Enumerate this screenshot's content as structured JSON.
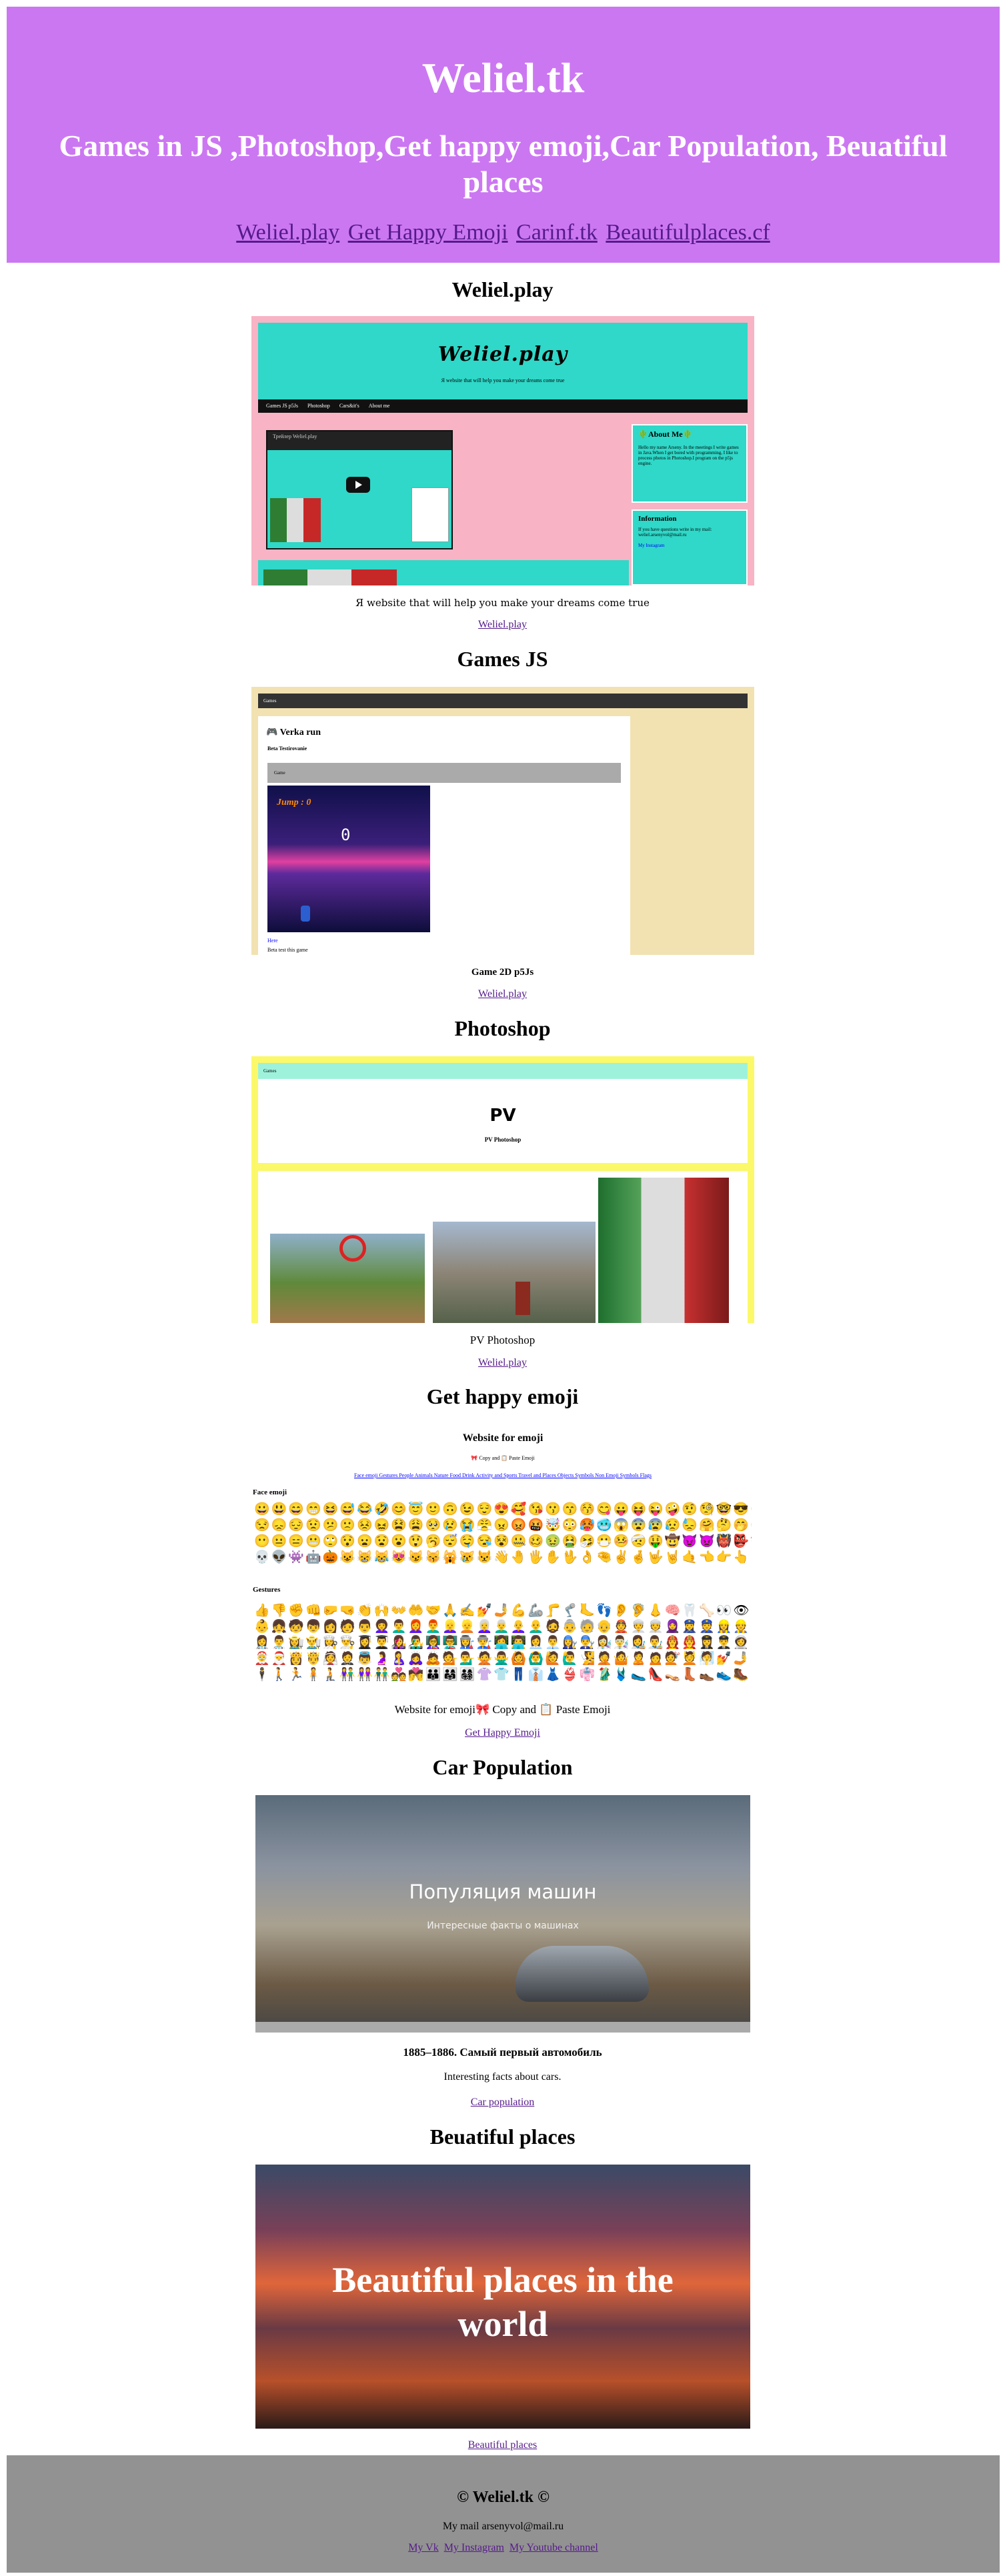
{
  "header": {
    "title": "Weliel.tk",
    "subtitle": "Games in JS ,Photoshop,Get happy emoji,Car Population, Beuatiful places",
    "nav": [
      "Weliel.play",
      "Get Happy Emoji",
      "Carinf.tk",
      "Beautifulplaces.cf"
    ]
  },
  "sections": {
    "welielplay": {
      "title": "Weliel.play",
      "caption": "Я website that will help you make your dreams come true",
      "link": "Weliel.play",
      "shot": {
        "logo": "Weliel.play",
        "tagline": "Я website that will help you make your dreams come true",
        "menu": [
          "Games JS p5Js",
          "Photoshop",
          "Cars&it's",
          "About me"
        ],
        "video_title": "Трейлер Weliel.play",
        "about_title": "🌵About Me🌵",
        "about_text": "Hello my name Arseny. In the meetings I write games in Java.When I get bored with programming, I like to process photos in Photoshop.I program on the p5js engine.",
        "info_title": "Information",
        "info_text": "If you have questions write in my mail: weliel.arsenyvol@mail.ru",
        "info_link": "My Instagram"
      }
    },
    "games": {
      "title": "Games JS",
      "caption": "Game 2D p5Js",
      "link": "Weliel.play",
      "shot": {
        "topbar": "Games",
        "game_title": "🎮 Verka run",
        "version": "Beta Testirovanie",
        "bar_label": "Game",
        "jump": "Jump : 0",
        "score": "0",
        "link_text": "Here",
        "sub": "Beta test this game"
      }
    },
    "photoshop": {
      "title": "Photoshop",
      "caption": "PV Photoshop",
      "link": "Weliel.play",
      "shot": {
        "nav": "Games",
        "logo": "PV",
        "sub": "PV Photoshop"
      }
    },
    "emoji": {
      "title": "Get happy emoji",
      "caption": "Website for emoji🎀 Copy and 📋 Paste Emoji",
      "link": "Get Happy Emoji",
      "shot": {
        "heading": "Website for emoji",
        "copy": "🎀 Copy and 📋 Paste Emoji",
        "cats": "Face emoji Gestures People Animals Nature Food Drink Activity and Sports Travel and Places Objects Symbols Non Emoji Symbols Flags",
        "face_label": "Face emoji",
        "gestures_label": "Gestures",
        "face_rows": [
          "😀😃😄😁😆😅😂🤣😊😇🙂🙃😉😌😍🥰😘😗😙😚😋😛😝😜🤪🤨🧐🤓😎🤩🥳😏",
          "😒😞😔😟😕🙁😣😖😫😩🥺😢😭😤😠😡🤬🤯😳🥵🥶😱😨😰😥😓🤗🤔🤭🤫🤥",
          "😶😐😑😬🙄😯😦😧😮😲🥱😴🤤😪😵🤐🥴🤢🤮🤧😷🤒🤕🤑🤠😈👿👹👺🤡💩👻",
          "💀👽👾🤖🎃😺😸😹😻😼😽🙀😿😾👋🤚🖐✋🖖👌🤏✌🤞🤟🤘🤙👈👉👆🖕👇☝"
        ],
        "gesture_rows": [
          "👍👎✊👊🤛🤜👏🙌👐🤲🤝🙏✍💅🤳💪🦾🦵🦿🦶👣👂🦻👃🧠🦷🦴👀👁👅👄💋🩸",
          "👶👧🧒👦👩🧑👨👩‍🦱👨‍🦱👩‍🦰👨‍🦰👱‍♀️👱👩‍🦳👨‍🦳👩‍🦲👨‍🦲🧔👵🧓👴👲👳‍♀️👳🧕👮‍♀️👮👷‍♀️👷💂‍♀️💂🕵",
          "👩‍⚕️👨‍⚕️👩‍🌾👨‍🌾👩‍🍳👨‍🍳👩‍🎓👨‍🎓👩‍🎤👨‍🎤👩‍🏫👨‍🏫👩‍🏭👨‍🏭👩‍💻👨‍💻👩‍💼👨‍💼👩‍🔧👨‍🔧👩‍🔬👨‍🔬👩‍🎨👨‍🎨👩‍🚒👨‍🚒👩‍✈️👨‍✈️👩‍🚀👨‍🚀👩‍⚖️",
          "🤶🎅👸🤴👰🤵👼🤰🤱🙇‍♀️🙇💁💁‍♂️🙅🙅‍♂️🙆🙆‍♂️🙋🙋‍♂️🧏🤦🤷🙎🙍💇💆🧖💅🤳💃🕺👯",
          "🕴🚶🏃🧍🧎👫👭👬💑💏👪👨‍👩‍👧👨‍👩‍👧‍👦👚👕👖👔👗👙👘🥻🩱🥿👠👡👢👞👟🥾🧦🧤🧣"
        ]
      }
    },
    "car": {
      "title": "Car Population",
      "heading": "1885–1886. Самый первый автомобиль",
      "caption": "Interesting facts about cars.",
      "link": "Car population",
      "shot": {
        "title": "Популяция машин",
        "sub": "Интересные факты о машинах"
      }
    },
    "places": {
      "title": "Beuatiful places",
      "link": "Beautiful places",
      "shot": {
        "title": "Beautiful places in the world"
      }
    }
  },
  "footer": {
    "copyright": "© Weliel.tk ©",
    "mail": "My mail arsenyvol@mail.ru",
    "links": [
      "My Vk",
      "My Instagram",
      "My Youtube channel"
    ]
  },
  "colors": {
    "header_bg": "#cc77f2",
    "footer_bg": "#929292",
    "link": "#551a8b"
  }
}
